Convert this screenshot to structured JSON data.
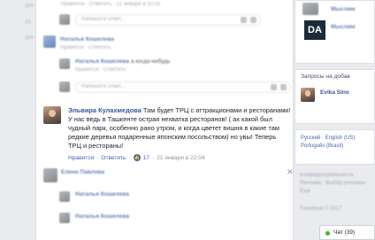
{
  "feed": {
    "comment_placeholder": "Напишите ответ...",
    "main_comment": {
      "author": "Эльвира Кулахмедова",
      "text": "Там будет ТРЦ с аттракционами и ресторанами! У нас ведь в Ташкенте острая нехватка ресторанов! ( ах какой был чудный парк, особенно рано утром, и когда цветет вишня в какие там редкие деревья подаренные японским посольством) но увы! Теперь ТРЦ и рестораны!",
      "like": "Нравится",
      "reply": "Ответить",
      "likes_count": "17",
      "time": "21 января в 22:04",
      "separator": "·"
    },
    "blurred": {
      "reply_row_1": "Нравится · Ответить · 21 января в 20:05",
      "reply_author_1": "Наталья Кошелева",
      "reply_author_1_text": "Ответить",
      "reply_row_2": "Нравится · Ответить",
      "reply_author_2": "Наталья Кошелева",
      "reply_author_2_text": "а когда-нибудь",
      "bottom_author": "Елена Павлова",
      "bottom_text": "Ответить"
    }
  },
  "right_col": {
    "brand_label": "DA",
    "brand_name_1": "Мыслим",
    "brand_name_2": "Мыслим",
    "requests_title": "Запросы на добав",
    "request_name": "Evika Sino",
    "languages": [
      "Русский",
      "English (US)",
      "Português (Brasil)"
    ],
    "footer_links": [
      "Конфиденциальность",
      "Реклама",
      "Выбор рекламы",
      "Еще"
    ],
    "copyright": "Facebook © 2017"
  },
  "chat": {
    "label": "Чат (39)"
  },
  "left_rail": {
    "counts": [
      "20+",
      "15",
      "20+"
    ]
  },
  "colors": {
    "link": "#365899",
    "meta": "#90949c",
    "background": "#e9ebee"
  }
}
